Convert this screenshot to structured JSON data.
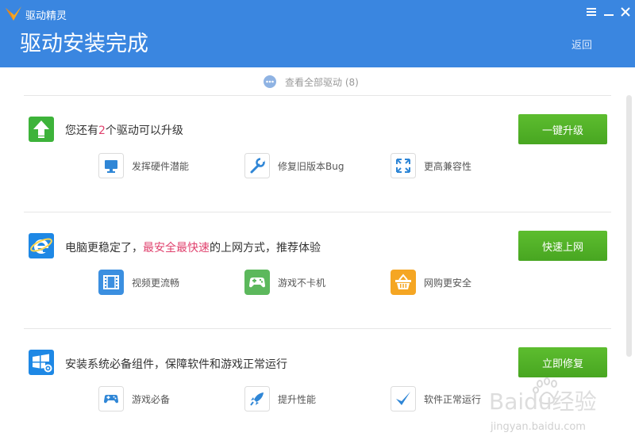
{
  "app": {
    "name": "驱动精灵"
  },
  "header": {
    "title": "驱动安装完成",
    "back_label": "返回"
  },
  "view_all": {
    "label": "查看全部驱动 (8)"
  },
  "sections": [
    {
      "message": {
        "pre": "您还有",
        "count": "2",
        "post": "个驱动可以升级"
      },
      "button_label": "一键升级",
      "features": [
        {
          "label": "发挥硬件潜能",
          "icon": "monitor-icon"
        },
        {
          "label": "修复旧版本Bug",
          "icon": "wrench-icon"
        },
        {
          "label": "更高兼容性",
          "icon": "expand-arrows-icon"
        }
      ]
    },
    {
      "message": {
        "pre": "电脑更稳定了，",
        "highlight": "最安全最快速",
        "post": "的上网方式，推荐体验"
      },
      "button_label": "快速上网",
      "features": [
        {
          "label": "视频更流畅",
          "icon": "video-film-icon"
        },
        {
          "label": "游戏不卡机",
          "icon": "gamepad-icon"
        },
        {
          "label": "网购更安全",
          "icon": "shopping-basket-icon"
        }
      ]
    },
    {
      "message": {
        "text": "安装系统必备组件，保障软件和游戏正常运行"
      },
      "button_label": "立即修复",
      "features": [
        {
          "label": "游戏必备",
          "icon": "gamepad-icon"
        },
        {
          "label": "提升性能",
          "icon": "rocket-icon"
        },
        {
          "label": "软件正常运行",
          "icon": "checkmark-icon"
        }
      ]
    }
  ],
  "watermark": {
    "brand": "Baidu经验",
    "url": "jingyan.baidu.com"
  },
  "colors": {
    "header": "#3a86e0",
    "button": "#4fae25",
    "highlight": "#e0426e"
  }
}
